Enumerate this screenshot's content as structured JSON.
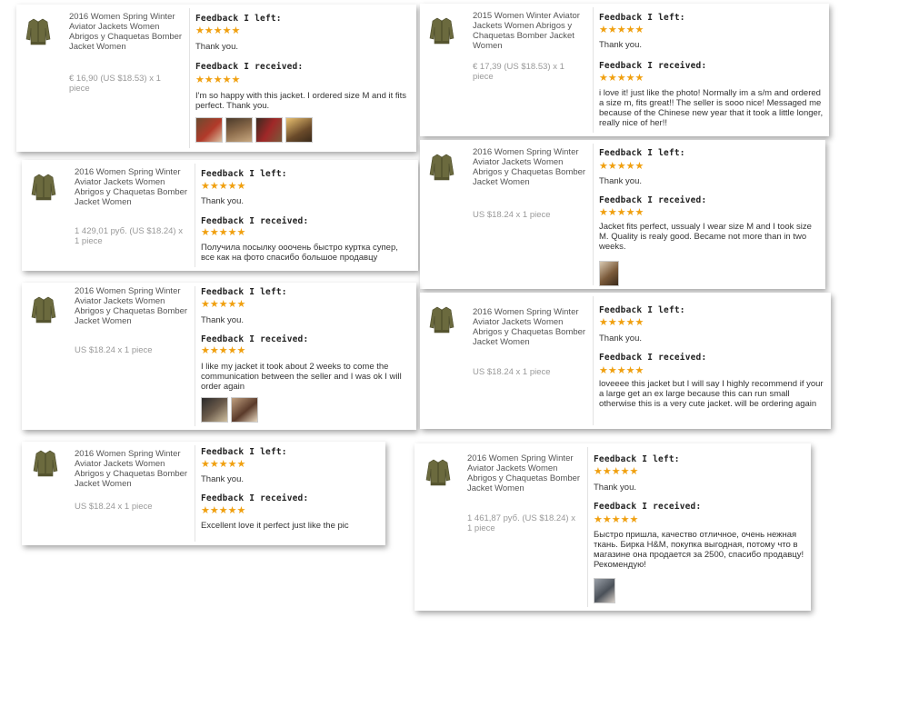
{
  "colors": {
    "star": "#f0a010",
    "price": "#999999",
    "jacket": "#6b6a3e"
  },
  "icons": {
    "product": "bomber-jacket-icon",
    "star": "star-icon"
  },
  "cards": [
    {
      "title": "2016 Women Spring Winter Aviator Jackets Women Abrigos y Chaquetas Bomber Jacket Women",
      "price": "€ 16,90 (US $18.53) x 1 piece",
      "left_label": "Feedback I left:",
      "left_stars": "★★★★★",
      "left_text": "Thank you.",
      "received_label": "Feedback I received:",
      "received_stars": "★★★★★",
      "received_text": "I'm so happy with this jacket. I ordered size M and it fits perfect. Thank you."
    },
    {
      "title": "2015 Women Winter Aviator Jackets Women Abrigos y Chaquetas Bomber Jacket Women",
      "price": "€ 17,39 (US $18.53) x 1 piece",
      "left_label": "Feedback I left:",
      "left_stars": "★★★★★",
      "left_text": "Thank you.",
      "received_label": "Feedback I received:",
      "received_stars": "★★★★★",
      "received_text": "i love it! just like the photo! Normally im a s/m and ordered a size m, fits great!! The seller is sooo nice! Messaged me because of the Chinese new year that it took a little longer, really nice of her!!"
    },
    {
      "title": "2016 Women Spring Winter Aviator Jackets Women Abrigos y Chaquetas Bomber Jacket Women",
      "price": "1 429,01 руб. (US $18.24) x 1 piece",
      "left_label": "Feedback I left:",
      "left_stars": "★★★★★",
      "left_text": "Thank you.",
      "received_label": "Feedback I received:",
      "received_stars": "★★★★★",
      "received_text": "Получила посылку ооочень быстро куртка супер, все как на фото спасибо большое продавцу"
    },
    {
      "title": "2016 Women Spring Winter Aviator Jackets Women Abrigos y Chaquetas Bomber Jacket Women",
      "price": "US $18.24 x 1 piece",
      "left_label": "Feedback I left:",
      "left_stars": "★★★★★",
      "left_text": "Thank you.",
      "received_label": "Feedback I received:",
      "received_stars": "★★★★★",
      "received_text": "Jacket fits perfect, ussualy I wear size M and I took size M. Quality is realy good. Became not more than in two weeks."
    },
    {
      "title": "2016 Women Spring Winter Aviator Jackets Women Abrigos y Chaquetas Bomber Jacket Women",
      "price": "US $18.24 x 1 piece",
      "left_label": "Feedback I left:",
      "left_stars": "★★★★★",
      "left_text": "Thank you.",
      "received_label": "Feedback I received:",
      "received_stars": "★★★★★",
      "received_text": "I like my jacket it took about 2 weeks to come the communication between the seller and I was ok I will order again"
    },
    {
      "title": "2016 Women Spring Winter Aviator Jackets Women Abrigos y Chaquetas Bomber Jacket Women",
      "price": "US $18.24 x 1 piece",
      "left_label": "Feedback I left:",
      "left_stars": "★★★★★",
      "left_text": "Thank you.",
      "received_label": "Feedback I received:",
      "received_stars": "★★★★★",
      "received_text": "loveeee this jacket but I will say I highly recommend if your a large get an ex large because this can run small otherwise this is a very cute jacket. will be ordering again"
    },
    {
      "title": "2016 Women Spring Winter Aviator Jackets Women Abrigos y Chaquetas Bomber Jacket Women",
      "price": "US $18.24 x 1 piece",
      "left_label": "Feedback I left:",
      "left_stars": "★★★★★",
      "left_text": "Thank you.",
      "received_label": "Feedback I received:",
      "received_stars": "★★★★★",
      "received_text": "Excellent love it perfect just like the pic"
    },
    {
      "title": "2016 Women Spring Winter Aviator Jackets Women Abrigos y Chaquetas Bomber Jacket Women",
      "price": "1 461,87 руб. (US $18.24) x 1 piece",
      "left_label": "Feedback I left:",
      "left_stars": "★★★★★",
      "left_text": "Thank you.",
      "received_label": "Feedback I received:",
      "received_stars": "★★★★★",
      "received_text": "Быстро пришла, качество отличное, очень нежная ткань. Бирка H&M, покупка выгодная, потому что в магазине она продается за 2500, спасибо продавцу! Рекомендую!"
    }
  ]
}
